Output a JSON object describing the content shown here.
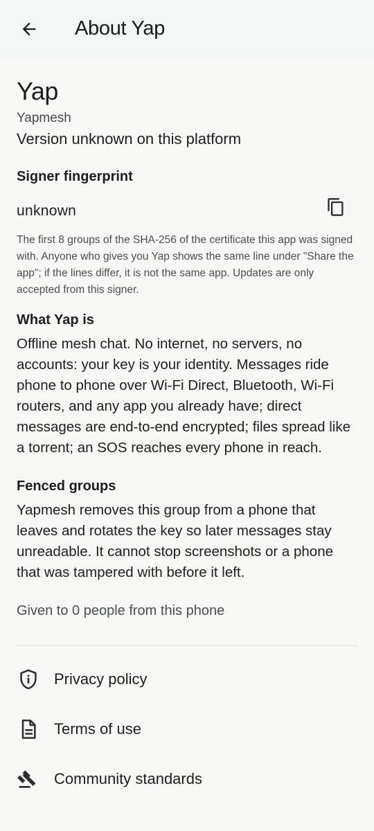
{
  "header": {
    "title": "About Yap",
    "back_icon": "arrow-back-icon"
  },
  "app": {
    "name": "Yap",
    "publisher": "Yapmesh",
    "version": "Version unknown on this platform"
  },
  "fingerprint": {
    "title": "Signer fingerprint",
    "value": "unknown",
    "copy_icon": "copy-icon",
    "help": "The first 8 groups of the SHA-256 of the certificate this app was signed with. Anyone who gives you Yap shows the same line under \"Share the app\"; if the lines differ, it is not the same app. Updates are only accepted from this signer."
  },
  "what": {
    "title": "What Yap is",
    "body": "Offline mesh chat. No internet, no servers, no accounts: your key is your identity. Messages ride phone to phone over Wi-Fi Direct, Bluetooth, Wi-Fi routers, and any app you already have; direct messages are end-to-end encrypted; files spread like a torrent; an SOS reaches every phone in reach."
  },
  "fenced": {
    "title": "Fenced groups",
    "body": "Yapmesh removes this group from a phone that leaves and rotates the key so later messages stay unreadable. It cannot stop screenshots or a phone that was tampered with before it left."
  },
  "given": "Given to 0 people from this phone",
  "links": [
    {
      "label": "Privacy policy",
      "icon": "shield-info-icon"
    },
    {
      "label": "Terms of use",
      "icon": "document-icon"
    },
    {
      "label": "Community standards",
      "icon": "gavel-icon"
    }
  ],
  "colors": {
    "background": "#f7f7f6",
    "app_bar": "#f2f6f5",
    "text": "#1d1f1f",
    "secondary_text": "#4a5050",
    "divider": "#d9dcdb"
  }
}
